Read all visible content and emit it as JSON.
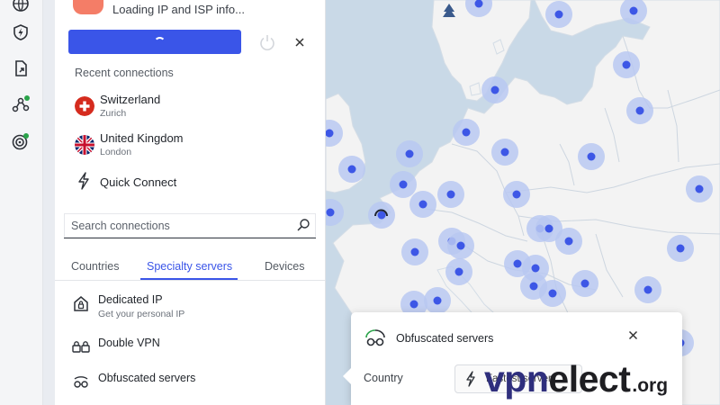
{
  "status": {
    "text": "Loading IP and ISP info..."
  },
  "recent": {
    "title": "Recent connections",
    "items": [
      {
        "name": "Switzerland",
        "city": "Zurich"
      },
      {
        "name": "United Kingdom",
        "city": "London"
      }
    ],
    "quick_connect": "Quick Connect"
  },
  "search": {
    "placeholder": "Search connections"
  },
  "tabs": {
    "countries": "Countries",
    "specialty": "Specialty servers",
    "devices": "Devices"
  },
  "specialty": [
    {
      "name": "Dedicated IP",
      "sub": "Get your personal IP"
    },
    {
      "name": "Double VPN"
    },
    {
      "name": "Obfuscated servers"
    }
  ],
  "popup": {
    "title": "Obfuscated servers",
    "country_label": "Country",
    "country_value": "Fastest server"
  },
  "watermark": {
    "main_a": "vpn",
    "main_b": "elect",
    "suffix": ".org"
  },
  "colors": {
    "accent": "#3a55e8",
    "map_water": "#c9d9e7",
    "map_land": "#f3f3f3",
    "server_dot": "#3d57e6"
  }
}
